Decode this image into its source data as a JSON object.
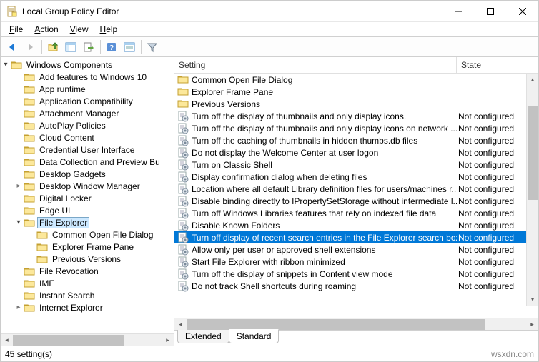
{
  "window": {
    "title": "Local Group Policy Editor"
  },
  "menu": {
    "file": "File",
    "action": "Action",
    "view": "View",
    "help": "Help"
  },
  "tree": {
    "root": "Windows Components",
    "items": [
      "Add features to Windows 10",
      "App runtime",
      "Application Compatibility",
      "Attachment Manager",
      "AutoPlay Policies",
      "Cloud Content",
      "Credential User Interface",
      "Data Collection and Preview Bu",
      "Desktop Gadgets",
      "Desktop Window Manager",
      "Digital Locker",
      "Edge UI",
      "File Explorer",
      "File Revocation",
      "IME",
      "Instant Search",
      "Internet Explorer"
    ],
    "file_explorer_children": [
      "Common Open File Dialog",
      "Explorer Frame Pane",
      "Previous Versions"
    ],
    "selected": "File Explorer"
  },
  "list": {
    "header_setting": "Setting",
    "header_state": "State",
    "folders": [
      "Common Open File Dialog",
      "Explorer Frame Pane",
      "Previous Versions"
    ],
    "rows": [
      {
        "setting": "Turn off the display of thumbnails and only display icons.",
        "state": "Not configured"
      },
      {
        "setting": "Turn off the display of thumbnails and only display icons on network ...",
        "state": "Not configured"
      },
      {
        "setting": "Turn off the caching of thumbnails in hidden thumbs.db files",
        "state": "Not configured"
      },
      {
        "setting": "Do not display the Welcome Center at user logon",
        "state": "Not configured"
      },
      {
        "setting": "Turn on Classic Shell",
        "state": "Not configured"
      },
      {
        "setting": "Display confirmation dialog when deleting files",
        "state": "Not configured"
      },
      {
        "setting": "Location where all default Library definition files for users/machines r...",
        "state": "Not configured"
      },
      {
        "setting": "Disable binding directly to IPropertySetStorage without intermediate l...",
        "state": "Not configured"
      },
      {
        "setting": "Turn off Windows Libraries features that rely on indexed file data",
        "state": "Not configured"
      },
      {
        "setting": "Disable Known Folders",
        "state": "Not configured"
      },
      {
        "setting": "Turn off display of recent search entries in the File Explorer search box",
        "state": "Not configured",
        "selected": true
      },
      {
        "setting": "Allow only per user or approved shell extensions",
        "state": "Not configured"
      },
      {
        "setting": "Start File Explorer with ribbon minimized",
        "state": "Not configured"
      },
      {
        "setting": "Turn off the display of snippets in Content view mode",
        "state": "Not configured"
      },
      {
        "setting": "Do not track Shell shortcuts during roaming",
        "state": "Not configured"
      }
    ]
  },
  "tabs": {
    "extended": "Extended",
    "standard": "Standard"
  },
  "status": {
    "text": "45 setting(s)",
    "watermark": "wsxdn.com"
  }
}
